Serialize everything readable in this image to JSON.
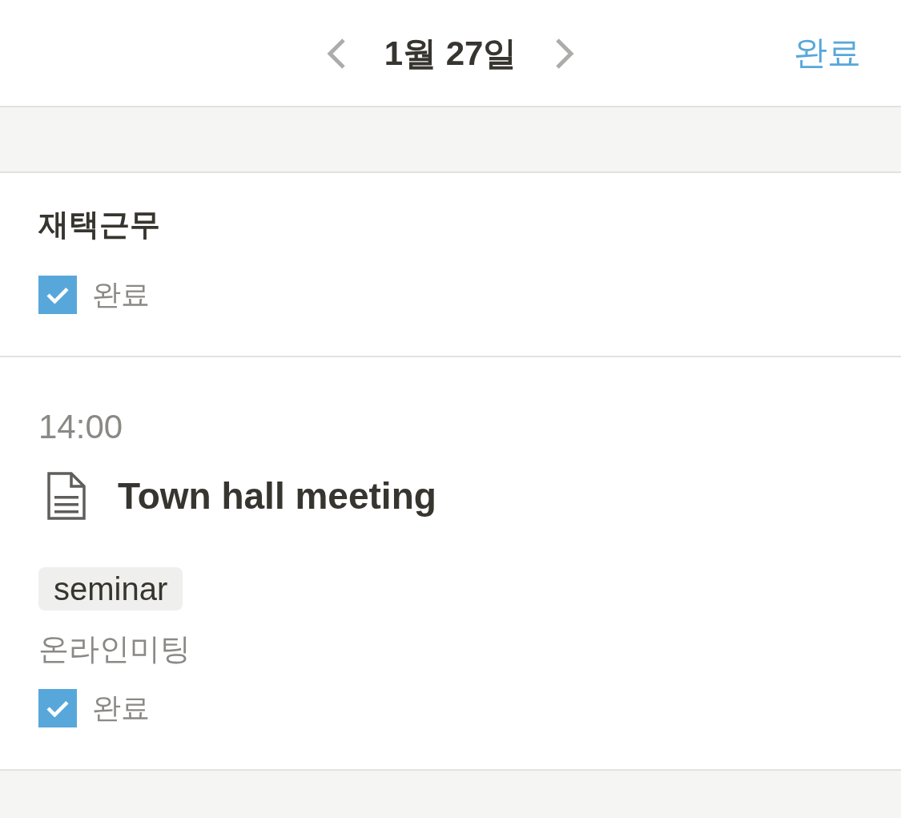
{
  "header": {
    "title": "1월 27일",
    "done_button": "완료"
  },
  "entries": [
    {
      "kind": "task",
      "title": "재택근무",
      "checkbox": {
        "label": "완료",
        "checked": true
      }
    },
    {
      "kind": "page",
      "time": "14:00",
      "title": "Town hall meeting",
      "tag": "seminar",
      "property": "온라인미팅",
      "checkbox": {
        "label": "완료",
        "checked": true
      }
    }
  ]
}
